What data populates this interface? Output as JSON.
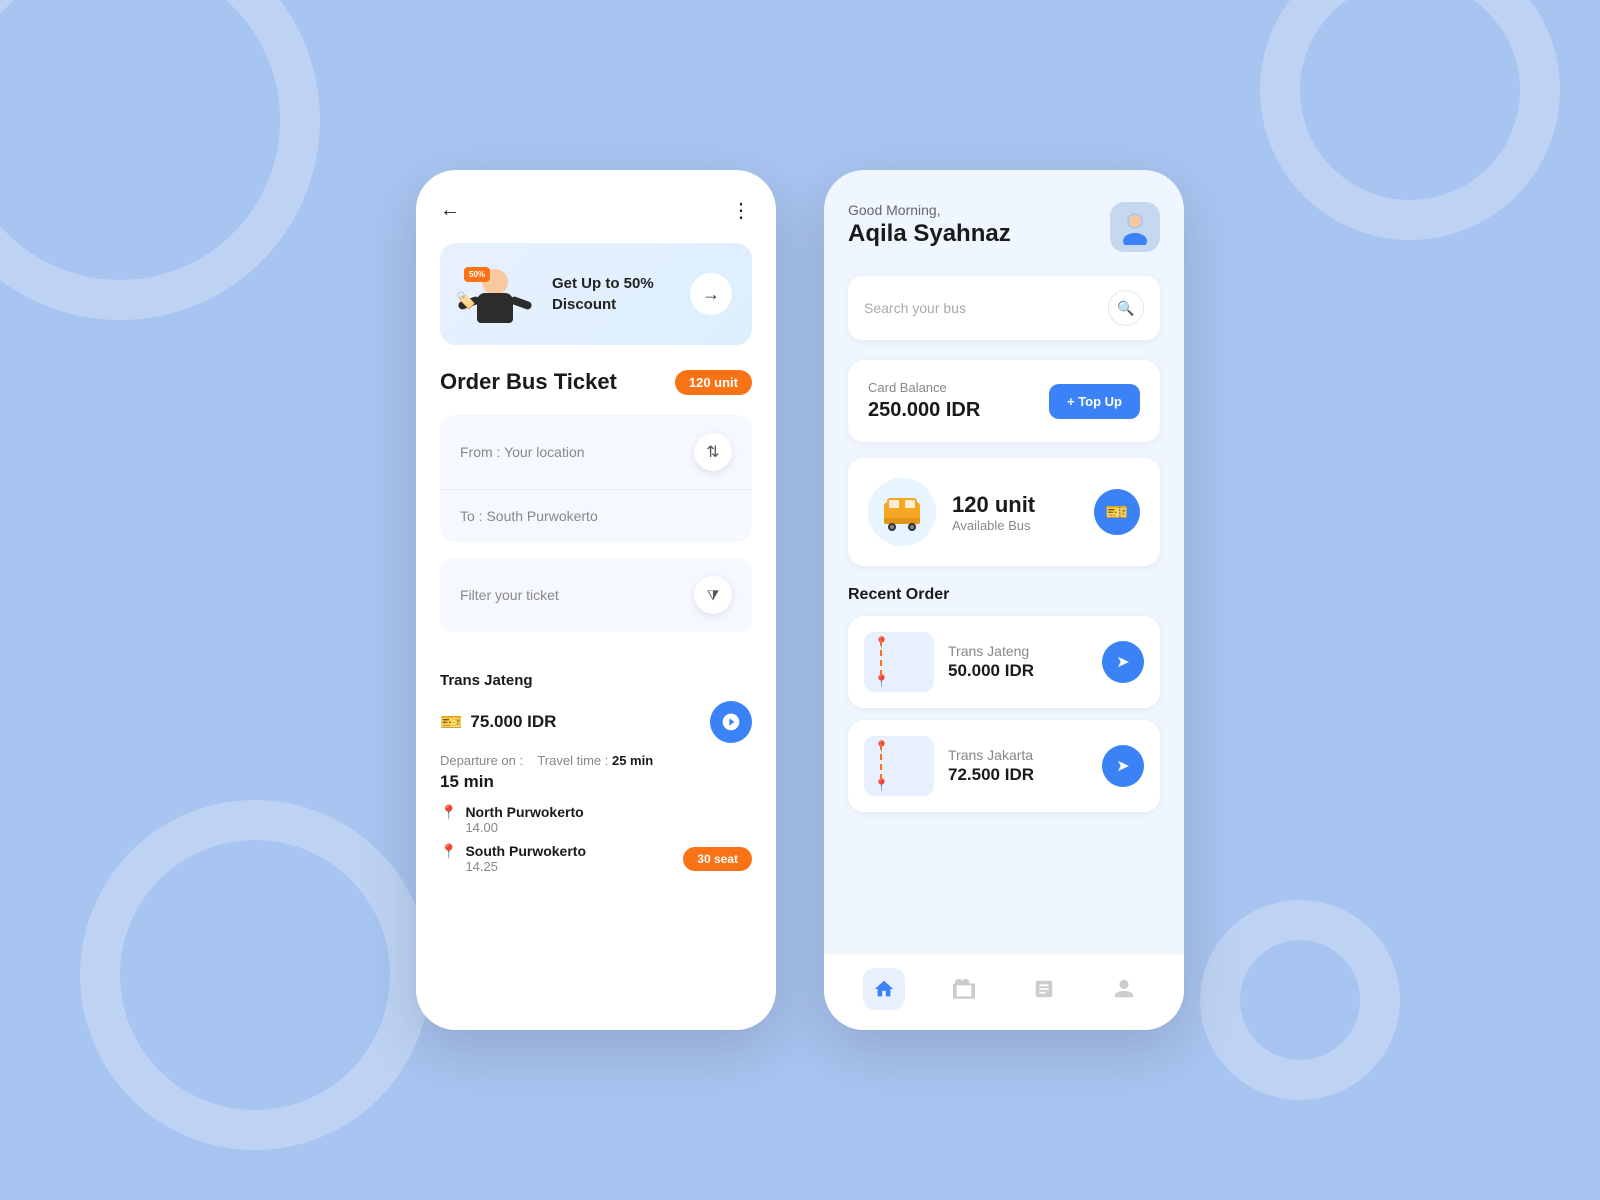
{
  "background": {
    "color": "#a8c4f0"
  },
  "phone1": {
    "header": {
      "back_label": "←",
      "more_label": "⋮"
    },
    "promo": {
      "title": "Get Up to\n50% Discount",
      "badge": "50%",
      "arrow": "→"
    },
    "order": {
      "title": "Order Bus Ticket",
      "unit_badge": "120 unit",
      "from_label": "From : Your location",
      "to_label": "To : South Purwokerto",
      "filter_label": "Filter your ticket"
    },
    "result": {
      "company": "Trans Jateng",
      "price": "75.000 IDR",
      "departure_label": "Departure on :",
      "travel_time_label": "Travel time :",
      "travel_time_value": "25 min",
      "departure_time": "15 min",
      "stop1_name": "North Purwokerto",
      "stop1_time": "14.00",
      "stop2_name": "South Purwokerto",
      "stop2_time": "14.25",
      "seat_badge": "30 seat"
    }
  },
  "phone2": {
    "greeting": "Good Morning,",
    "user_name": "Aqila Syahnaz",
    "search_placeholder": "Search your bus",
    "balance": {
      "label": "Card Balance",
      "amount": "250.000 IDR",
      "topup_label": "+ Top Up"
    },
    "bus_info": {
      "count": "120 unit",
      "sub": "Available Bus"
    },
    "recent": {
      "title": "Recent Order",
      "orders": [
        {
          "company": "Trans Jateng",
          "price": "50.000 IDR"
        },
        {
          "company": "Trans Jakarta",
          "price": "72.500 IDR"
        }
      ]
    },
    "nav": {
      "home": "🏠",
      "tickets": "🎫",
      "orders": "📋",
      "profile": "👤"
    }
  }
}
